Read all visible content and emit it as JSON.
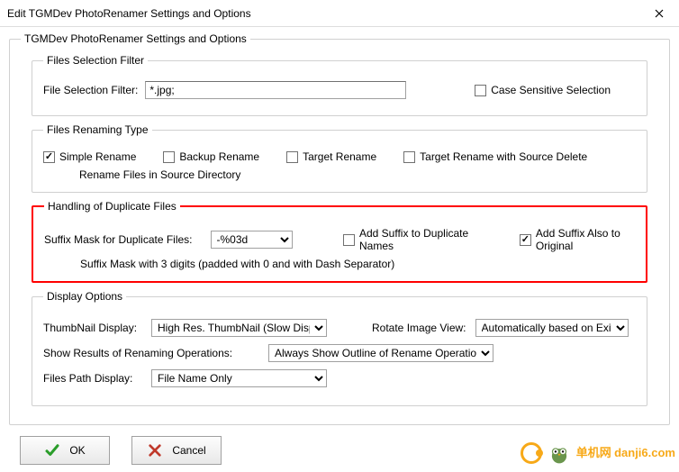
{
  "window": {
    "title": "Edit TGMDev PhotoRenamer Settings and Options"
  },
  "main_group": {
    "legend": "TGMDev PhotoRenamer Settings and Options"
  },
  "filter_group": {
    "legend": "Files Selection Filter",
    "label": "File Selection Filter:",
    "value": "*.jpg;",
    "case_sensitive": {
      "label": "Case Sensitive Selection",
      "checked": false
    }
  },
  "rename_group": {
    "legend": "Files Renaming Type",
    "simple": {
      "label": "Simple Rename",
      "checked": true
    },
    "backup": {
      "label": "Backup Rename",
      "checked": false
    },
    "target": {
      "label": "Target Rename",
      "checked": false
    },
    "target_delete": {
      "label": "Target Rename with Source Delete",
      "checked": false
    },
    "subtext": "Rename Files in Source Directory"
  },
  "dup_group": {
    "legend": "Handling of Duplicate Files",
    "mask_label": "Suffix Mask for Duplicate Files:",
    "mask_value": "-%03d",
    "add_suffix": {
      "label": "Add Suffix to Duplicate Names",
      "checked": false
    },
    "add_orig": {
      "label": "Add Suffix Also to Original",
      "checked": true
    },
    "hint": "Suffix Mask with 3 digits (padded with 0 and with Dash Separator)"
  },
  "display_group": {
    "legend": "Display Options",
    "thumbnail_label": "ThumbNail Display:",
    "thumbnail_value": "High Res. ThumbNail (Slow Display)",
    "rotate_label": "Rotate Image View:",
    "rotate_value": "Automatically based on Exif",
    "results_label": "Show Results of Renaming Operations:",
    "results_value": "Always Show Outline of Rename Operations",
    "path_label": "Files Path Display:",
    "path_value": "File Name Only"
  },
  "buttons": {
    "ok": "OK",
    "cancel": "Cancel"
  },
  "watermark": {
    "text": "单机网",
    "sub": "danji6.com"
  }
}
